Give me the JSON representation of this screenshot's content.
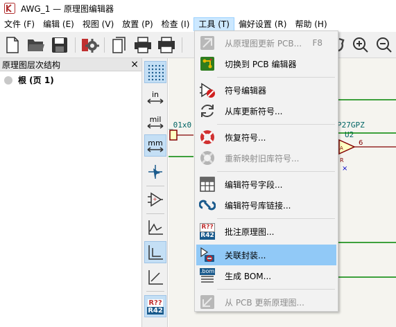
{
  "window": {
    "title": "AWG_1 — 原理图编辑器"
  },
  "menubar": {
    "items": [
      {
        "label": "文件 (F)"
      },
      {
        "label": "编辑 (E)"
      },
      {
        "label": "视图 (V)"
      },
      {
        "label": "放置 (P)"
      },
      {
        "label": "检查 (I)"
      },
      {
        "label": "工具 (T)"
      },
      {
        "label": "偏好设置 (R)"
      },
      {
        "label": "帮助 (H)"
      }
    ]
  },
  "hierarchy": {
    "title": "原理图层次结构",
    "close": "×",
    "root_label": "根 (页 1)"
  },
  "left_toolbar": {
    "unit_in": "in",
    "unit_mil": "mil",
    "unit_mm": "mm",
    "annotate_line1": "R??",
    "annotate_line2": "R42"
  },
  "canvas": {
    "part_left": "_01x0",
    "part_ref": "P27GPZ",
    "part_id": "U2",
    "pin_number": "6",
    "label_a": "A",
    "label_r": "R",
    "mark_x": "×"
  },
  "tools_menu": {
    "items": [
      {
        "label": "从原理图更新 PCB...",
        "shortcut": "F8"
      },
      {
        "label": "切换到 PCB 编辑器"
      },
      {
        "label": "符号编辑器"
      },
      {
        "label": "从库更新符号..."
      },
      {
        "label": "恢复符号..."
      },
      {
        "label": "重新映射旧库符号..."
      },
      {
        "label": "编辑符号字段..."
      },
      {
        "label": "编辑符号库链接..."
      },
      {
        "label": "批注原理图...",
        "icon_line1": "R??",
        "icon_line2": "R42"
      },
      {
        "label": "关联封装..."
      },
      {
        "label": "生成 BOM...",
        "icon_text": ".bom"
      },
      {
        "label": "从 PCB 更新原理图..."
      }
    ]
  },
  "colors": {
    "highlight": "#91c9f7",
    "active_menu": "#cce8ff",
    "wire": "#008400",
    "symbol_fill": "#ffffc2",
    "symbol_border": "#840000",
    "text_teal": "#006464"
  }
}
